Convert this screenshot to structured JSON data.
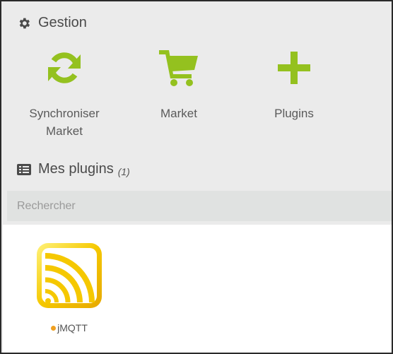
{
  "gestion": {
    "title": "Gestion",
    "actions": [
      {
        "label": "Synchroniser Market",
        "icon": "sync-icon"
      },
      {
        "label": "Market",
        "icon": "cart-icon"
      },
      {
        "label": "Plugins",
        "icon": "plus-icon"
      }
    ]
  },
  "mes_plugins": {
    "title": "Mes plugins",
    "count": "(1)",
    "search_placeholder": "Rechercher",
    "plugins": [
      {
        "name": "jMQTT",
        "status_color": "#f0a020",
        "icon": "jmqtt-logo-icon"
      }
    ]
  },
  "colors": {
    "accent": "#94c11f",
    "logo_yellow": "#f5c800"
  }
}
